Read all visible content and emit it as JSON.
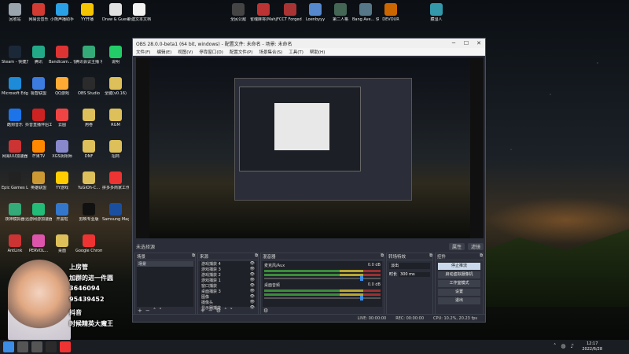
{
  "desktop": {
    "icons": [
      {
        "label": "回收站",
        "color": "#9aa4ad"
      },
      {
        "label": "网易云音乐",
        "color": "#d33a31"
      },
      {
        "label": "小熊声播助手",
        "color": "#2aa0e6"
      },
      {
        "label": "YY开播",
        "color": "#f5c400"
      },
      {
        "label": "Draw & Guess",
        "color": "#e0e0e0"
      },
      {
        "label": "新建文本文档",
        "color": "#f2f2f2"
      },
      {
        "label": "全民公敌",
        "color": "#444"
      },
      {
        "label": "雀魂麻将(Mahjong...",
        "color": "#b33"
      },
      {
        "label": "FCCT Forged ...",
        "color": "#a33"
      },
      {
        "label": "Loenbyyy",
        "color": "#58c"
      },
      {
        "label": "第二人格",
        "color": "#465"
      },
      {
        "label": "Bang Ave... 快速方式",
        "color": "#578"
      },
      {
        "label": "DEVOUR",
        "color": "#c60"
      },
      {
        "label": "藏湿人",
        "color": "#39a"
      },
      {
        "label": "Steam - 快捷方式",
        "color": "#1b2838"
      },
      {
        "label": "腾讯",
        "color": "#2a8"
      },
      {
        "label": "Bandicam... 快捷方式",
        "color": "#d33"
      },
      {
        "label": "腾讯会议主播 项目部-20...",
        "color": "#3a7"
      },
      {
        "label": "说明",
        "color": "#2c6"
      },
      {
        "label": "Microsoft Edge",
        "color": "#1e8bd8"
      },
      {
        "label": "极智联盟",
        "color": "#3c7be0"
      },
      {
        "label": "QQ游戏",
        "color": "#fa3"
      },
      {
        "label": "OBS Studio",
        "color": "#2b2b2b"
      },
      {
        "label": "全键(v0.16)",
        "color": "#ddc05a"
      },
      {
        "label": "酷狗音乐",
        "color": "#1d74e8"
      },
      {
        "label": "抖音直播伴侣工具",
        "color": "#c22"
      },
      {
        "label": "云图",
        "color": "#e44"
      },
      {
        "label": "用卷",
        "color": "#ddc05a"
      },
      {
        "label": "RGM",
        "color": "#ddc05a"
      },
      {
        "label": "网易UU加速器",
        "color": "#c33"
      },
      {
        "label": "芒果TV",
        "color": "#f80"
      },
      {
        "label": "XGS阴阳师",
        "color": "#88c"
      },
      {
        "label": "DNF",
        "color": "#ddc05a"
      },
      {
        "label": "招商",
        "color": "#ddc05a"
      },
      {
        "label": "Epic Games Launcher",
        "color": "#222"
      },
      {
        "label": "英雄联盟",
        "color": "#c93"
      },
      {
        "label": "YY游戏",
        "color": "#fc0"
      },
      {
        "label": "YuGiOh-C...",
        "color": "#ddc05a"
      },
      {
        "label": "拼多多商家工作台",
        "color": "#e33"
      },
      {
        "label": "夜神模拟器",
        "color": "#3a7"
      },
      {
        "label": "迅游网游加速器",
        "color": "#2b7"
      },
      {
        "label": "开黑啦",
        "color": "#37c"
      },
      {
        "label": "剪映专业版",
        "color": "#111"
      },
      {
        "label": "Samsung Magician",
        "color": "#1a4fa0"
      },
      {
        "label": "AntLink",
        "color": "#c33"
      },
      {
        "label": "PERVOL...",
        "color": "#d5a"
      },
      {
        "label": "桌面",
        "color": "#ddc05a"
      },
      {
        "label": "Google Chrome",
        "color": "#e33"
      }
    ]
  },
  "obs": {
    "title": "OBS 28.0.0-beta1 (64 bit, windows) - 配置文件: 未命名 - 场景: 未命名",
    "menu": [
      "文件(F)",
      "编辑(E)",
      "视图(V)",
      "停靠窗口(D)",
      "配置文件(P)",
      "场景集合(S)",
      "工具(T)",
      "帮助(H)"
    ],
    "scene_label": "未选择源",
    "scene_buttons": [
      "属性",
      "滤镜"
    ],
    "docks": {
      "scenes": {
        "title": "场景",
        "items": [
          "场景"
        ]
      },
      "sources": {
        "title": "来源",
        "items": [
          "游戏捕获 4",
          "游戏捕获 3",
          "游戏捕获 2",
          "游戏捕获 1",
          "窗口捕获",
          "桌面捕获 3",
          "图像",
          "摄像头",
          "显示器捕获"
        ]
      },
      "mixer": {
        "title": "混音器",
        "tracks": [
          {
            "name": "麦克风/Aux",
            "db": "0.0 dB"
          },
          {
            "name": "桌面音频",
            "db": "0.0 dB"
          }
        ]
      },
      "transitions": {
        "title": "转场特效",
        "type": "淡出",
        "duration_label": "时长",
        "duration": "300 ms"
      },
      "controls": {
        "title": "控件",
        "buttons": [
          "停止推流",
          "启动虚拟摄像机",
          "工作室模式",
          "设置",
          "退出"
        ]
      }
    },
    "status": {
      "live": "LIVE: 00:00:00",
      "rec": "REC: 00:00:00",
      "cpu": "CPU: 10.2%, 20.23 fps"
    }
  },
  "overlay": {
    "lines": [
      "上房管",
      "加群的进一件圆",
      "3646094",
      "95439452",
      "抖音",
      "时候精英大魔王"
    ]
  },
  "taskbar": {
    "time": "12:17",
    "date": "2022/6/28",
    "apps": [
      {
        "name": "start",
        "color": "#3b8de6"
      },
      {
        "name": "search",
        "color": "#555"
      },
      {
        "name": "taskview",
        "color": "#555"
      },
      {
        "name": "obs",
        "color": "#2b2b2b"
      },
      {
        "name": "chrome",
        "color": "#e33"
      }
    ]
  }
}
